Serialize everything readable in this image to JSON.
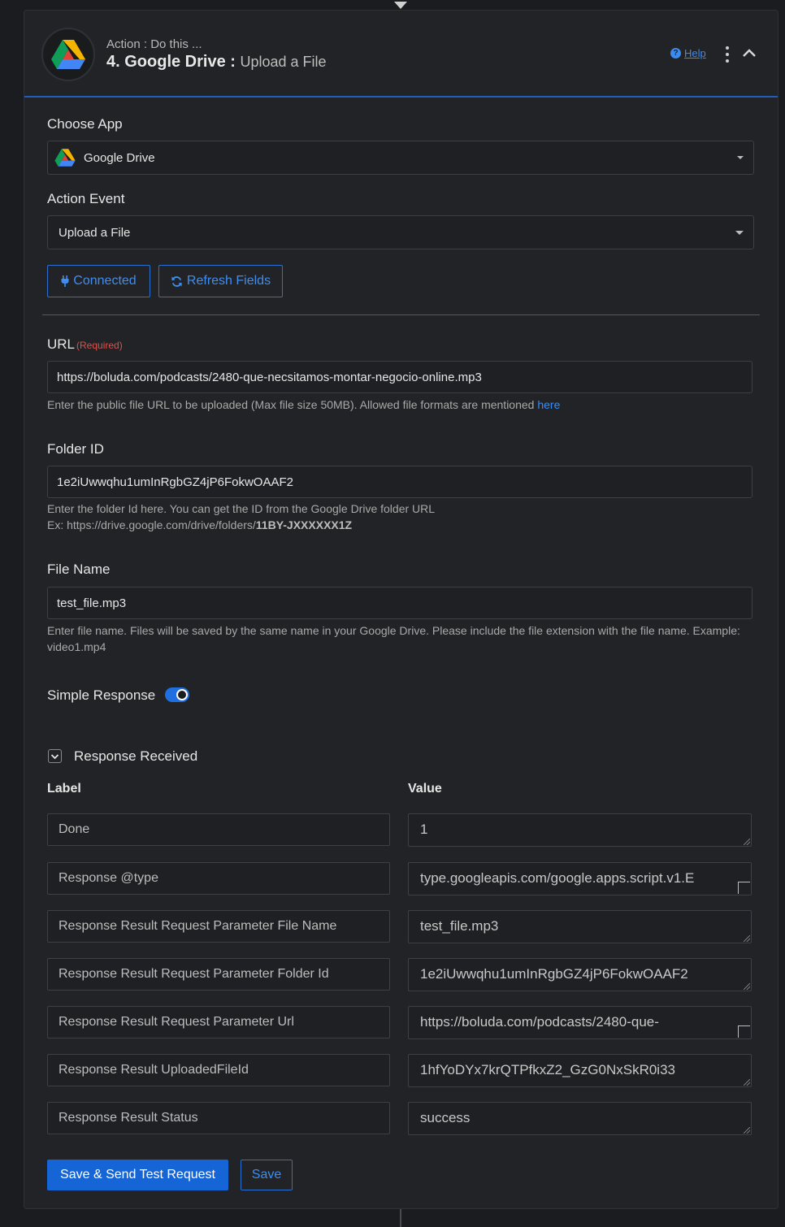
{
  "header": {
    "subtitle": "Action : Do this ...",
    "step_title": "4. Google Drive :",
    "step_event": "Upload a File",
    "help_label": "Help"
  },
  "choose_app": {
    "label": "Choose App",
    "selected": "Google Drive"
  },
  "action_event": {
    "label": "Action Event",
    "selected": "Upload a File"
  },
  "buttons": {
    "connected": "Connected",
    "refresh_fields": "Refresh Fields",
    "save_send": "Save & Send Test Request",
    "save": "Save"
  },
  "url_field": {
    "label": "URL",
    "required": "(Required)",
    "value": "https://boluda.com/podcasts/2480-que-necsitamos-montar-negocio-online.mp3",
    "help": "Enter the public file URL to be uploaded (Max file size 50MB). Allowed file formats are mentioned",
    "help_link": "here"
  },
  "folder_field": {
    "label": "Folder ID",
    "value": "1e2iUwwqhu1umInRgbGZ4jP6FokwOAAF2",
    "help_line1": "Enter the folder Id here. You can get the ID from the Google Drive folder URL",
    "help_line2_prefix": "Ex: https://drive.google.com/drive/folders/",
    "help_line2_bold": "11BY-JXXXXXX1Z"
  },
  "filename_field": {
    "label": "File Name",
    "value": "test_file.mp3",
    "help": "Enter file name. Files will be saved by the same name in your Google Drive. Please include the file extension with the file name. Example: video1.mp4"
  },
  "simple_response": {
    "label": "Simple Response",
    "enabled": true
  },
  "response_received": {
    "label": "Response Received",
    "col_label": "Label",
    "col_value": "Value",
    "rows": [
      {
        "label": "Done",
        "value": "1"
      },
      {
        "label": "Response @type",
        "value": "type.googleapis.com/google.apps.script.v1.E"
      },
      {
        "label": "Response Result Request Parameter File Name",
        "value": "test_file.mp3"
      },
      {
        "label": "Response Result Request Parameter Folder Id",
        "value": "1e2iUwwqhu1umInRgbGZ4jP6FokwOAAF2"
      },
      {
        "label": "Response Result Request Parameter Url",
        "value": "https://boluda.com/podcasts/2480-que-"
      },
      {
        "label": "Response Result UploadedFileId",
        "value": "1hfYoDYx7krQTPfkxZ2_GzG0NxSkR0i33"
      },
      {
        "label": "Response Result Status",
        "value": "success"
      }
    ]
  },
  "colors": {
    "accent": "#1565d6",
    "link": "#3b8cf0",
    "required": "#e0504a",
    "background": "#222326"
  }
}
